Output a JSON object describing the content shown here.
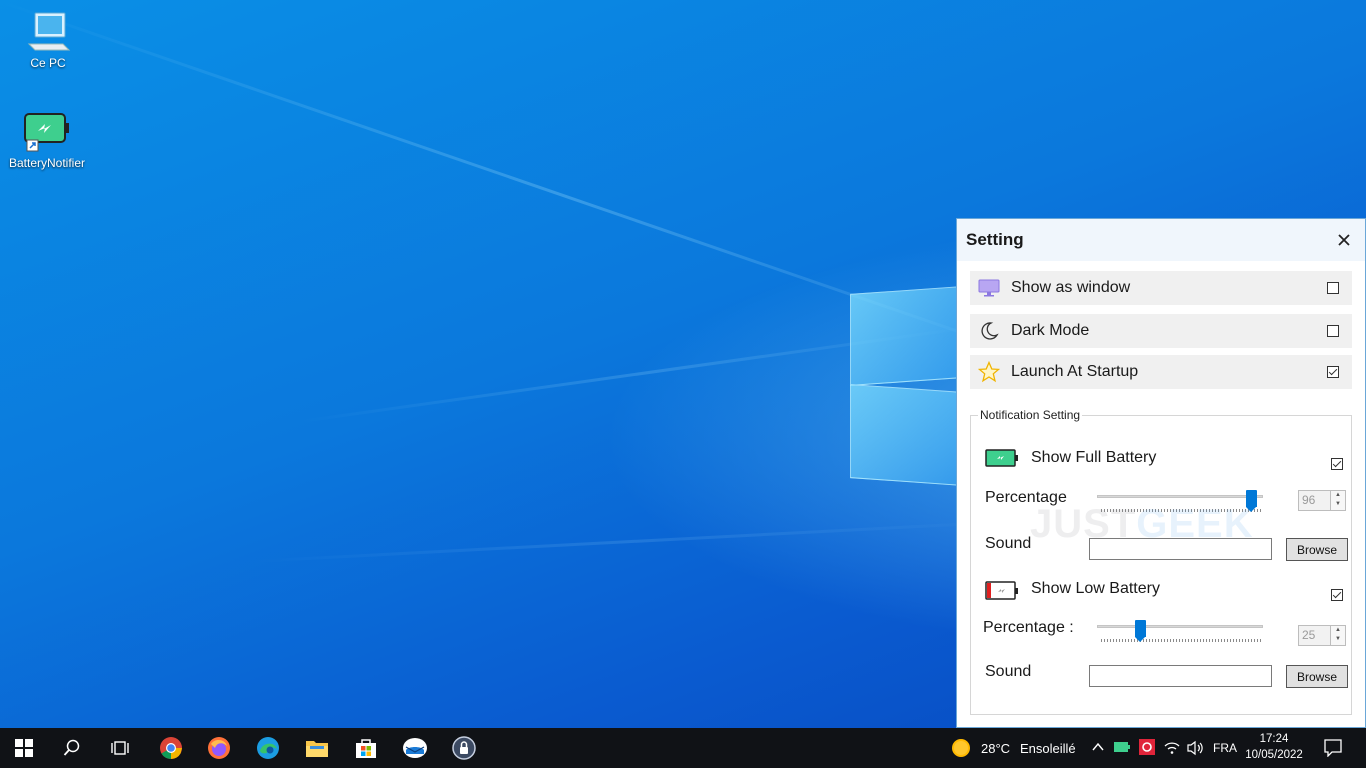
{
  "desktop": {
    "icons": [
      {
        "label": "Ce PC",
        "icon": "computer-icon"
      },
      {
        "label": "BatteryNotifier",
        "icon": "battery-app-icon"
      }
    ]
  },
  "settings": {
    "title": "Setting",
    "close_icon": "close-icon",
    "options": [
      {
        "label": "Show as window",
        "icon": "monitor-icon",
        "checked": false
      },
      {
        "label": "Dark Mode",
        "icon": "moon-icon",
        "checked": false
      },
      {
        "label": "Launch At Startup",
        "icon": "star-icon",
        "checked": true
      }
    ],
    "notification": {
      "legend": "Notification Setting",
      "full": {
        "label": "Show Full Battery",
        "checked": true,
        "percentage_label": "Percentage",
        "percentage_value": "96",
        "sound_label": "Sound",
        "sound_value": "",
        "browse_label": "Browse"
      },
      "low": {
        "label": "Show Low Battery",
        "checked": true,
        "percentage_label": "Percentage :",
        "percentage_value": "25",
        "sound_label": "Sound",
        "sound_value": "",
        "browse_label": "Browse"
      }
    }
  },
  "watermark": {
    "part1": "JUST",
    "part2": "GEEK"
  },
  "taskbar": {
    "apps": [
      "windows-start-icon",
      "search-icon",
      "task-view-icon",
      "chrome-icon",
      "firefox-icon",
      "edge-icon",
      "file-explorer-icon",
      "store-icon",
      "mail-icon",
      "vpn-lock-icon"
    ],
    "weather": {
      "temp": "28°C",
      "condition": "Ensoleillé"
    },
    "language": "FRA",
    "time": "17:24",
    "date": "10/05/2022"
  },
  "colors": {
    "accent": "#0078d7",
    "taskbar": "#101216",
    "window_border": "#6aa7d8"
  }
}
